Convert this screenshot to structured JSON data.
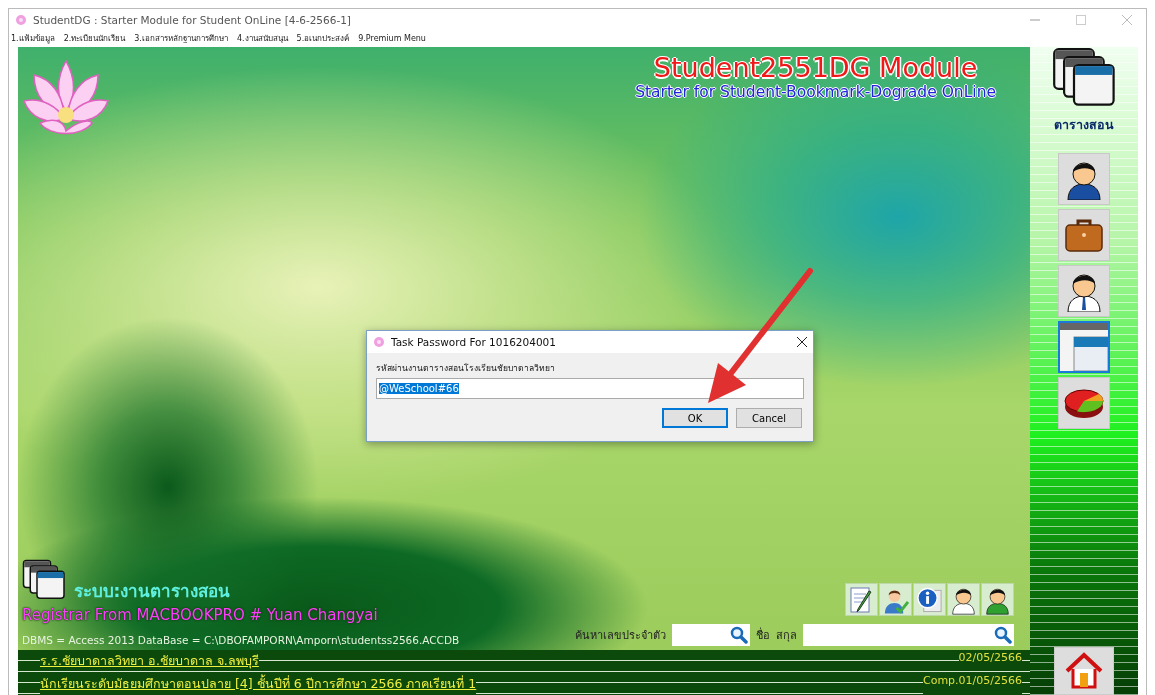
{
  "window": {
    "title": "StudentDG : Starter Module for Student OnLine [4-6-2566-1]"
  },
  "menu": [
    "1.แฟ้มข้อมูล",
    "2.ทะเบียนนักเรียน",
    "3.เอกสารหลักฐานการศึกษา",
    "4.งานสนับสนุน",
    "5.อเนกประสงค์",
    "9.Premium Menu"
  ],
  "header": {
    "title": "Student2551DG Module",
    "subtitle": "Starter for Student-Bookmark-Dograde OnLine"
  },
  "sidebar": {
    "caption": "ตารางสอน",
    "items": [
      {
        "kind": "person",
        "selected": false
      },
      {
        "kind": "briefcase",
        "selected": false
      },
      {
        "kind": "person-tie",
        "selected": false
      },
      {
        "kind": "window",
        "selected": true
      },
      {
        "kind": "chart",
        "selected": false
      }
    ]
  },
  "module": {
    "name": "ระบบ:งานตารางสอน",
    "registrar": "Registrar From MACBOOKPRO # Yuan Changyai",
    "dbms": "DBMS = Access 2013  DataBase = C:\\DBOFAMPORN\\Amporn\\studentss2566.ACCDB"
  },
  "tools": [
    {
      "kind": "edit"
    },
    {
      "kind": "user-check"
    },
    {
      "kind": "info"
    },
    {
      "kind": "person"
    },
    {
      "kind": "person-green"
    }
  ],
  "search": {
    "id_label": "ค้นหาเลขประจำตัว",
    "name_label": "ชื่อ",
    "surname_label": "สกุล"
  },
  "footer": {
    "school": "ร.ร.ชัยบาดาลวิทยา  อ.ชัยบาดาล  จ.ลพบุรี",
    "date": "02/05/2566",
    "level": "นักเรียนระดับมัธยมศึกษาตอนปลาย [4]  ชั้นปีที่ 6  ปีการศึกษา 2566  ภาคเรียนที่  1",
    "comp": "Comp.01/05/2566"
  },
  "dialog": {
    "title": "Task Password For 1016204001",
    "prompt": "รหัสผ่านงานตารางสอนโรงเรียนชัยบาดาลวิทยา",
    "value": "@WeSchool#66",
    "buttons": [
      {
        "label": "OK",
        "default": true
      },
      {
        "label": "Cancel",
        "default": false
      }
    ]
  }
}
